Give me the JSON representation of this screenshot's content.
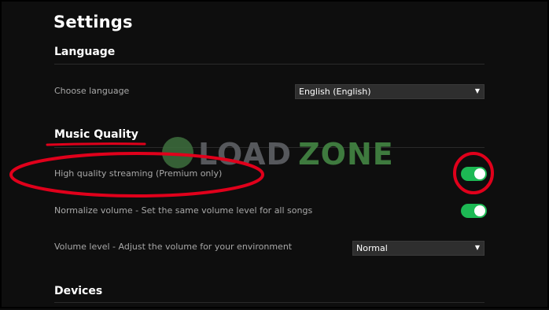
{
  "page": {
    "title": "Settings"
  },
  "sections": {
    "language": {
      "heading": "Language",
      "choose_label": "Choose language",
      "selected_language": "English (English)"
    },
    "music_quality": {
      "heading": "Music Quality",
      "high_quality_label": "High quality streaming (Premium only)",
      "high_quality_on": true,
      "normalize_label": "Normalize volume - Set the same volume level for all songs",
      "normalize_on": true,
      "volume_level_label": "Volume level - Adjust the volume for your environment",
      "volume_level_value": "Normal"
    },
    "devices": {
      "heading": "Devices"
    }
  },
  "watermark": {
    "word1": "LOAD",
    "word2": "ZONE"
  },
  "colors": {
    "background": "#0e0e0e",
    "toggle_on": "#1db954",
    "annotation": "#e0001b",
    "watermark_green": "#3e7a3e"
  },
  "icons": {
    "dropdown": "caret-down-icon",
    "logo": "loadzone-logo-icon"
  }
}
